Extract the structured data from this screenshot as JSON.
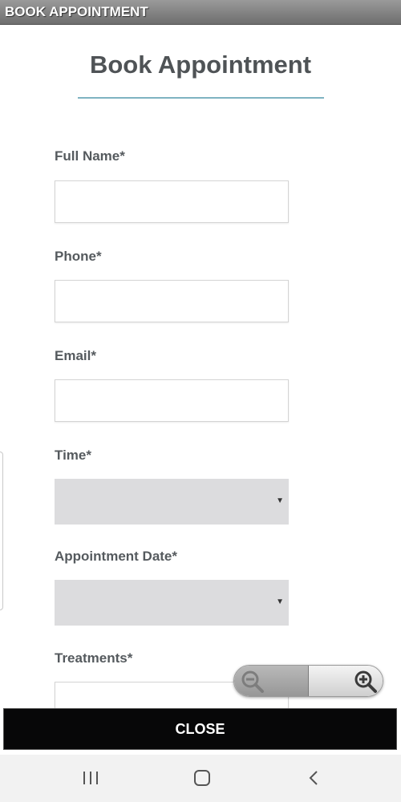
{
  "window": {
    "title": "BOOK APPOINTMENT"
  },
  "form": {
    "title": "Book Appointment",
    "fields": [
      {
        "label": "Full Name*",
        "value": ""
      },
      {
        "label": "Phone*",
        "value": ""
      },
      {
        "label": "Email*",
        "value": ""
      },
      {
        "label": "Time*",
        "value": ""
      },
      {
        "label": "Appointment Date*",
        "value": ""
      },
      {
        "label": "Treatments*",
        "value": ""
      }
    ]
  },
  "close_button": {
    "label": "CLOSE"
  },
  "zoom": {
    "out_icon": "zoom-out-icon",
    "in_icon": "zoom-in-icon"
  },
  "navbar": {
    "icons": [
      "recent-apps-icon",
      "home-icon",
      "back-icon"
    ]
  },
  "colors": {
    "titlebar": "#7f7f7f",
    "title_text": "#4f5356",
    "accent_rule": "#7fb3c1",
    "select_bg": "#dcdcde",
    "close_bg": "#070708",
    "navbar_bg": "#f2f2f2"
  }
}
